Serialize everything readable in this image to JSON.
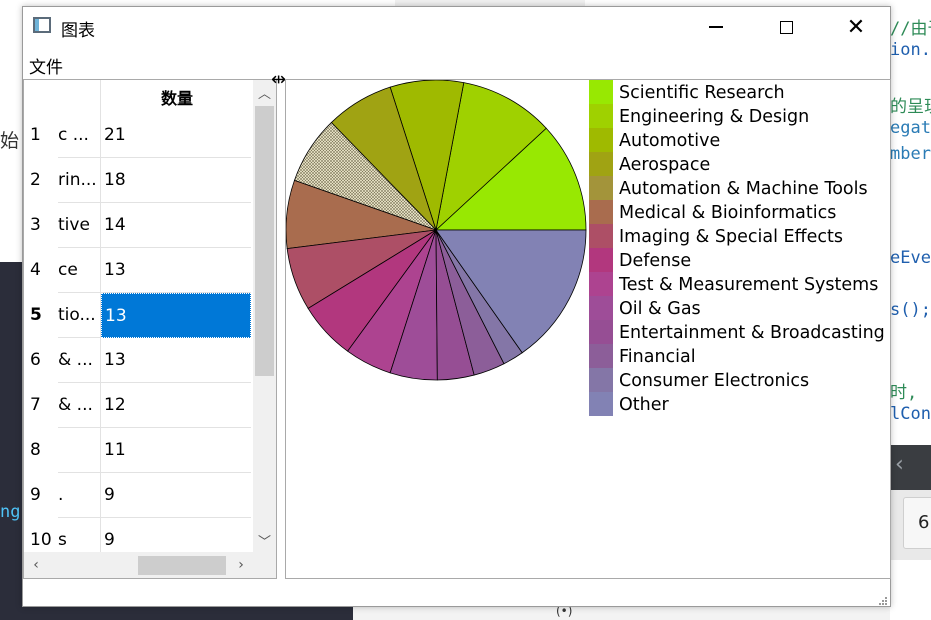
{
  "window": {
    "title": "图表",
    "close_glyph": "✕"
  },
  "menu": {
    "items": [
      "文件"
    ]
  },
  "table": {
    "header_b": "数量",
    "rows": [
      {
        "num": "1",
        "a": "c ...",
        "b": "21"
      },
      {
        "num": "2",
        "a": "rin...",
        "b": "18"
      },
      {
        "num": "3",
        "a": "tive",
        "b": "14"
      },
      {
        "num": "4",
        "a": "ce",
        "b": "13"
      },
      {
        "num": "5",
        "a": "tio...",
        "b": "13",
        "selected": true
      },
      {
        "num": "6",
        "a": "& ...",
        "b": "13"
      },
      {
        "num": "7",
        "a": "& ...",
        "b": "12"
      },
      {
        "num": "8",
        "a": "",
        "b": "11"
      },
      {
        "num": "9",
        "a": ".",
        "b": "9"
      },
      {
        "num": "10",
        "a": "s",
        "b": "9"
      }
    ]
  },
  "chart_data": {
    "type": "pie",
    "legend": "right",
    "categories": [
      "Scientific Research",
      "Engineering & Design",
      "Automotive",
      "Aerospace",
      "Automation & Machine Tools",
      "Medical & Bioinformatics",
      "Imaging & Special Effects",
      "Defense",
      "Test & Measurement Systems",
      "Oil & Gas",
      "Entertainment & Broadcasting",
      "Financial",
      "Consumer Electronics",
      "Other"
    ],
    "values": [
      21,
      18,
      14,
      13,
      13,
      13,
      12,
      11,
      9,
      9,
      7,
      6,
      4,
      27
    ],
    "colors": [
      "#98e802",
      "#9fd100",
      "#9fba00",
      "#a0a313",
      "#a3943a",
      "#a96c4e",
      "#ad4f66",
      "#b2377e",
      "#ad4390",
      "#9e4d98",
      "#964e94",
      "#8c5e99",
      "#8476a7",
      "#8282b4"
    ],
    "highlight_slice_index": 4
  },
  "background": {
    "code_lines": [
      {
        "text": "//由于猜",
        "color": "#2e8b57"
      },
      {
        "text": "ion.",
        "color": "#1f5fae"
      },
      {
        "text": "",
        "color": "#000000"
      },
      {
        "text": "的呈现",
        "color": "#2e8b57"
      },
      {
        "text": "egat",
        "color": "#2a7bb5"
      },
      {
        "text": "mber",
        "color": "#2a7bb5"
      },
      {
        "text": "",
        "color": "#000000"
      },
      {
        "text": "",
        "color": "#000000"
      },
      {
        "text": "",
        "color": "#000000"
      },
      {
        "text": "eEve",
        "color": "#1f5fae"
      },
      {
        "text": "",
        "color": "#000000"
      },
      {
        "text": "s();",
        "color": "#1f5fae"
      },
      {
        "text": "",
        "color": "#000000"
      },
      {
        "text": "",
        "color": "#000000"
      },
      {
        "text": "时,",
        "color": "#2e8b57"
      },
      {
        "text": "lCon",
        "color": "#1f5fae"
      }
    ],
    "left_char": "始",
    "left_code": "ng",
    "tab_label": "6",
    "bottom_symbol": "(•)"
  }
}
